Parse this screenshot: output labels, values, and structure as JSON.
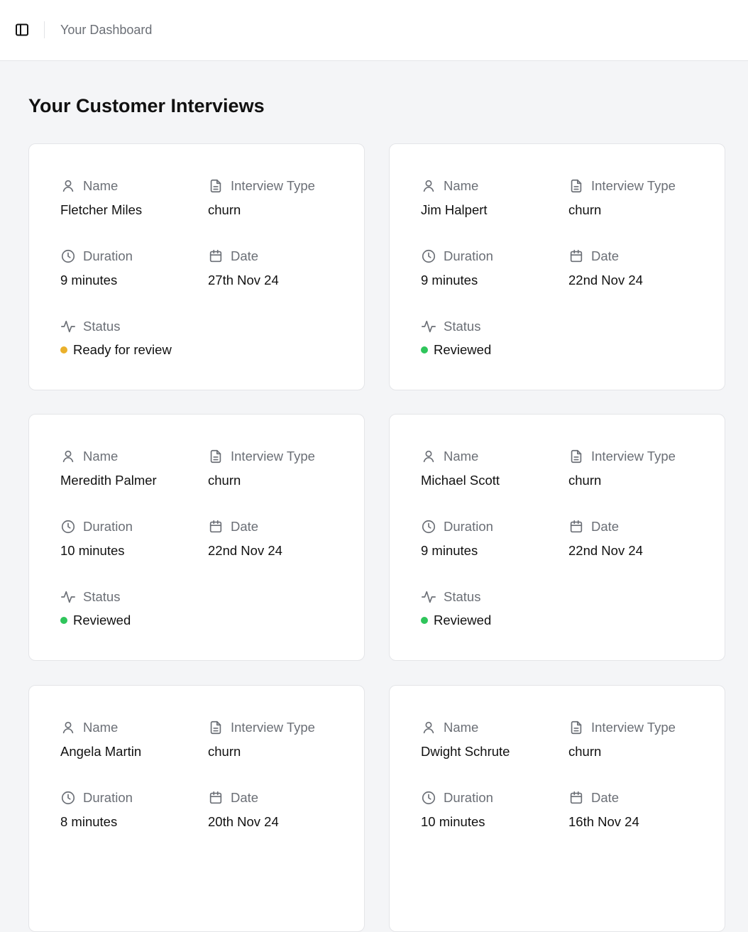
{
  "header": {
    "breadcrumb": "Your Dashboard"
  },
  "page": {
    "title": "Your Customer Interviews"
  },
  "labels": {
    "name": "Name",
    "interview_type": "Interview Type",
    "duration": "Duration",
    "date": "Date",
    "status": "Status"
  },
  "status_colors": {
    "Ready for review": "#eab02b",
    "Reviewed": "#2fc55b"
  },
  "interviews": [
    {
      "name": "Fletcher Miles",
      "type": "churn",
      "duration": "9 minutes",
      "date": "27th Nov 24",
      "status": "Ready for review"
    },
    {
      "name": "Jim Halpert",
      "type": "churn",
      "duration": "9 minutes",
      "date": "22nd Nov 24",
      "status": "Reviewed"
    },
    {
      "name": "Meredith Palmer",
      "type": "churn",
      "duration": "10 minutes",
      "date": "22nd Nov 24",
      "status": "Reviewed"
    },
    {
      "name": "Michael Scott",
      "type": "churn",
      "duration": "9 minutes",
      "date": "22nd Nov 24",
      "status": "Reviewed"
    },
    {
      "name": "Angela Martin",
      "type": "churn",
      "duration": "8 minutes",
      "date": "20th Nov 24"
    },
    {
      "name": "Dwight Schrute",
      "type": "churn",
      "duration": "10 minutes",
      "date": "16th Nov 24"
    }
  ]
}
